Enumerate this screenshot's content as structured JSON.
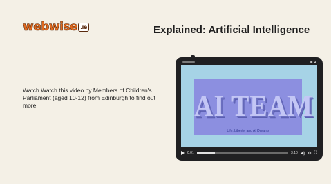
{
  "logo": {
    "brand": "webwise",
    "badge": ".ie"
  },
  "title": "Explained: Artificial Intelligence",
  "description": "Watch Watch this video by Members of Children's Parliament (aged 10-12) from Edinburgh to find out more.",
  "video": {
    "title": "AI TEAM",
    "caption": "Life, Liberty, and AI Dreams",
    "time_current": "0:01",
    "time_total": "3:10",
    "progress_fraction": 0.2
  },
  "icons": {
    "play": "play-icon",
    "volume": "volume-icon",
    "settings": "gear-icon",
    "fullscreen": "fullscreen-icon"
  },
  "colors": {
    "background": "#f4f0e6",
    "brand_orange": "#e26a1f",
    "screen_bg": "#a6d3e6",
    "video_bg": "#8c8fe0"
  }
}
